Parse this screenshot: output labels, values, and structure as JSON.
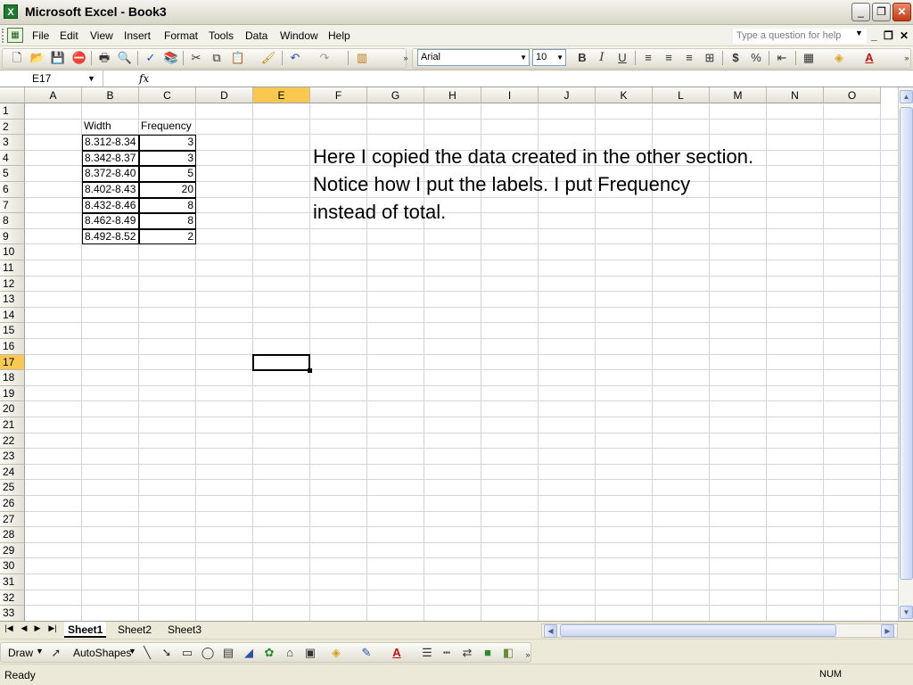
{
  "window": {
    "title": "Microsoft Excel - Book3",
    "app_icon": "X",
    "minimize_glyph": "_",
    "restore_glyph": "❐",
    "close_glyph": "✕"
  },
  "menu": {
    "items": [
      "File",
      "Edit",
      "View",
      "Insert",
      "Format",
      "Tools",
      "Data",
      "Window",
      "Help"
    ],
    "help_placeholder": "Type a question for help",
    "mdi_min": "_",
    "mdi_restore": "❐",
    "mdi_close": "✕"
  },
  "toolbar": {
    "font_name": "Arial",
    "font_size": "10",
    "bold": "B",
    "italic": "I",
    "underline": "U",
    "currency": "$",
    "percent": "%",
    "font_color": "A"
  },
  "formula_bar": {
    "name_box": "E17",
    "fx_label": "fx",
    "formula": ""
  },
  "grid": {
    "columns": [
      "A",
      "B",
      "C",
      "D",
      "E",
      "F",
      "G",
      "H",
      "I",
      "J",
      "K",
      "L",
      "M",
      "N",
      "O"
    ],
    "active_column": "E",
    "active_row": 17,
    "row_count": 33,
    "header_width": "Width",
    "header_frequency": "Frequency",
    "rows": [
      {
        "width": "8.312-8.34",
        "frequency": "3"
      },
      {
        "width": "8.342-8.37",
        "frequency": "3"
      },
      {
        "width": "8.372-8.40",
        "frequency": "5"
      },
      {
        "width": "8.402-8.43",
        "frequency": "20"
      },
      {
        "width": "8.432-8.46",
        "frequency": "8"
      },
      {
        "width": "8.462-8.49",
        "frequency": "8"
      },
      {
        "width": "8.492-8.52",
        "frequency": "2"
      }
    ],
    "note": "Here I copied the data created in the other section.  Notice how I put the labels.  I put Frequency instead of total."
  },
  "sheets": {
    "tabs": [
      "Sheet1",
      "Sheet2",
      "Sheet3"
    ],
    "active": "Sheet1"
  },
  "draw_toolbar": {
    "draw_label": "Draw",
    "autoshapes_label": "AutoShapes"
  },
  "status": {
    "text": "Ready",
    "num": "NUM"
  },
  "colors": {
    "active_header": "#f8c850",
    "grid_line": "#d4d4d4",
    "chrome": "#ece9d8"
  }
}
